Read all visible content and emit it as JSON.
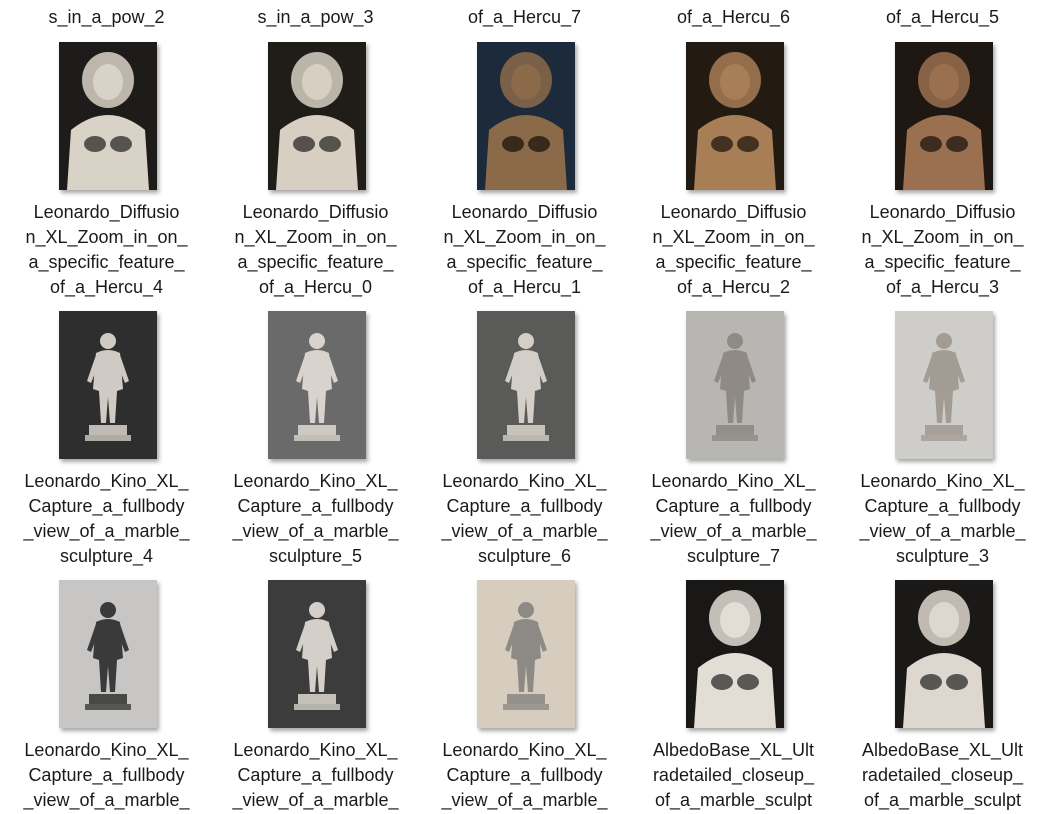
{
  "window": {
    "view": "Large icons"
  },
  "top_row_labels": [
    "s_in_a_pow_2",
    "s_in_a_pow_3",
    "of_a_Hercu_7",
    "of_a_Hercu_6",
    "of_a_Hercu_5"
  ],
  "files": [
    {
      "label": "Leonardo_Diffusio\nn_XL_Zoom_in_on_\na_specific_feature_\nof_a_Hercu_4",
      "thumb": "lion-marble-bust-light",
      "bg": "#1e1c1a",
      "fig": "#d9d2c6"
    },
    {
      "label": "Leonardo_Diffusio\nn_XL_Zoom_in_on_\na_specific_feature_\nof_a_Hercu_0",
      "thumb": "lion-marble-bust-gold",
      "bg": "#201c18",
      "fig": "#d7cfc2"
    },
    {
      "label": "Leonardo_Diffusio\nn_XL_Zoom_in_on_\na_specific_feature_\nof_a_Hercu_1",
      "thumb": "lion-head-dark-blue",
      "bg": "#1d2a3c",
      "fig": "#8a6a48"
    },
    {
      "label": "Leonardo_Diffusio\nn_XL_Zoom_in_on_\na_specific_feature_\nof_a_Hercu_2",
      "thumb": "lion-bronze-torso",
      "bg": "#231a12",
      "fig": "#a87e56"
    },
    {
      "label": "Leonardo_Diffusio\nn_XL_Zoom_in_on_\na_specific_feature_\nof_a_Hercu_3",
      "thumb": "lion-bronze-warrior",
      "bg": "#1f1711",
      "fig": "#9a7050"
    },
    {
      "label": "Leonardo_Kino_XL_\nCapture_a_fullbody\n_view_of_a_marble_\nsculpture_4",
      "thumb": "marble-statue-hall",
      "bg": "#2e2e2e",
      "fig": "#cfcac3"
    },
    {
      "label": "Leonardo_Kino_XL_\nCapture_a_fullbody\n_view_of_a_marble_\nsculpture_5",
      "thumb": "marble-statue-grey",
      "bg": "#6a6a6a",
      "fig": "#d8d3cc"
    },
    {
      "label": "Leonardo_Kino_XL_\nCapture_a_fullbody\n_view_of_a_marble_\nsculpture_6",
      "thumb": "marble-statue-pedestal",
      "bg": "#5a5a58",
      "fig": "#d3cec7"
    },
    {
      "label": "Leonardo_Kino_XL_\nCapture_a_fullbody\n_view_of_a_marble_\nsculpture_7",
      "thumb": "marble-statue-staff",
      "bg": "#b8b6b3",
      "fig": "#8f8a84"
    },
    {
      "label": "Leonardo_Kino_XL_\nCapture_a_fullbody\n_view_of_a_marble_\nsculpture_3",
      "thumb": "marble-statue-seated",
      "bg": "#cfcdca",
      "fig": "#a29c95"
    },
    {
      "label": "Leonardo_Kino_XL_\nCapture_a_fullbody\n_view_of_a_marble_",
      "thumb": "dark-statue-grey",
      "bg": "#c7c6c4",
      "fig": "#3a3a3a"
    },
    {
      "label": "Leonardo_Kino_XL_\nCapture_a_fullbody\n_view_of_a_marble_",
      "thumb": "marble-statue-darkbg",
      "bg": "#3c3c3c",
      "fig": "#d4cfc8"
    },
    {
      "label": "Leonardo_Kino_XL_\nCapture_a_fullbody\n_view_of_a_marble_",
      "thumb": "marble-statue-beige",
      "bg": "#d6cdbf",
      "fig": "#8d8a86"
    },
    {
      "label": "AlbedoBase_XL_Ult\nradetailed_closeup_\nof_a_marble_sculpt",
      "thumb": "marble-bust-closeup",
      "bg": "#1a1816",
      "fig": "#e2ddd5"
    },
    {
      "label": "AlbedoBase_XL_Ult\nradetailed_closeup_\nof_a_marble_sculpt",
      "thumb": "marble-bust-flexing",
      "bg": "#1b1917",
      "fig": "#ddd7cf"
    }
  ]
}
